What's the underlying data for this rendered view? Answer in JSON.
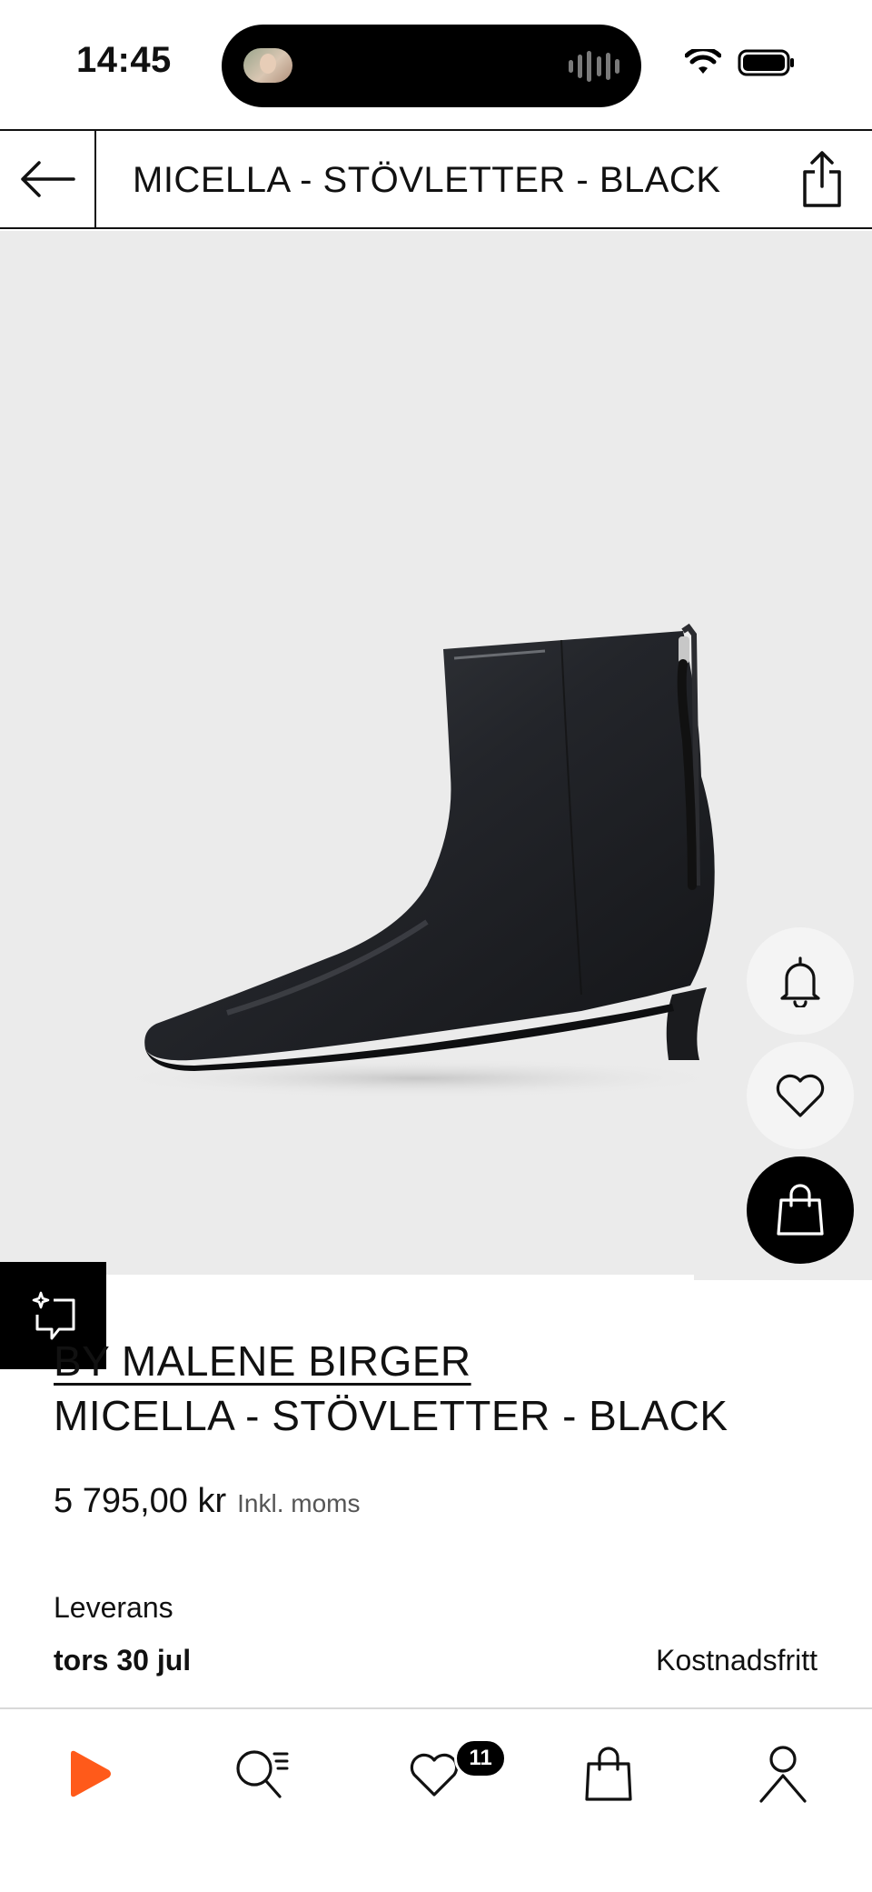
{
  "status_bar": {
    "time": "14:45"
  },
  "header": {
    "title": "MICELLA - STÖVLETTER - BLACK"
  },
  "product": {
    "brand": "BY MALENE BIRGER",
    "name": "MICELLA - STÖVLETTER - BLACK",
    "price": "5 795,00 kr",
    "vat_note": "Inkl. moms",
    "image": "black-leather-ankle-boot"
  },
  "delivery": {
    "label": "Leverans",
    "date": "tors 30 jul",
    "cost": "Kostnadsfritt"
  },
  "actions": {
    "notify": "bell-icon",
    "wishlist": "heart-icon",
    "add_to_bag": "bag-icon",
    "similar": "sparkle-similar-icon"
  },
  "bottom_nav": {
    "items": [
      "home-icon",
      "search-icon",
      "wishlist-icon",
      "bag-icon",
      "account-icon"
    ],
    "wishlist_count": "11"
  },
  "colors": {
    "brand_accent": "#ff5a1a",
    "image_background": "#ebebeb",
    "text": "#111111"
  }
}
